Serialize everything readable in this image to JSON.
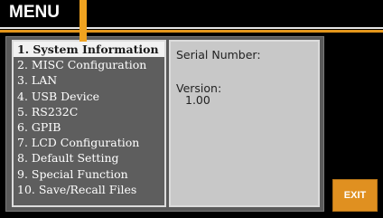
{
  "header": {
    "title": "MENU"
  },
  "menu": {
    "items": [
      {
        "label": "1. System Information"
      },
      {
        "label": "2. MISC Configuration"
      },
      {
        "label": "3. LAN"
      },
      {
        "label": "4. USB Device"
      },
      {
        "label": "5. RS232C"
      },
      {
        "label": "6. GPIB"
      },
      {
        "label": "7. LCD Configuration"
      },
      {
        "label": "8. Default Setting"
      },
      {
        "label": "9. Special Function"
      },
      {
        "label": "10. Save/Recall Files"
      }
    ],
    "selected_label": "1. System Information"
  },
  "info": {
    "serial_label": "Serial Number:",
    "version_label": "Version:",
    "version_value": "1.00"
  },
  "softkeys": {
    "exit_label": "EXIT"
  },
  "colors": {
    "accent": "#e3951b",
    "background": "#000000",
    "panel": "#5a5a5a",
    "info_bg": "#c8c8c8"
  }
}
